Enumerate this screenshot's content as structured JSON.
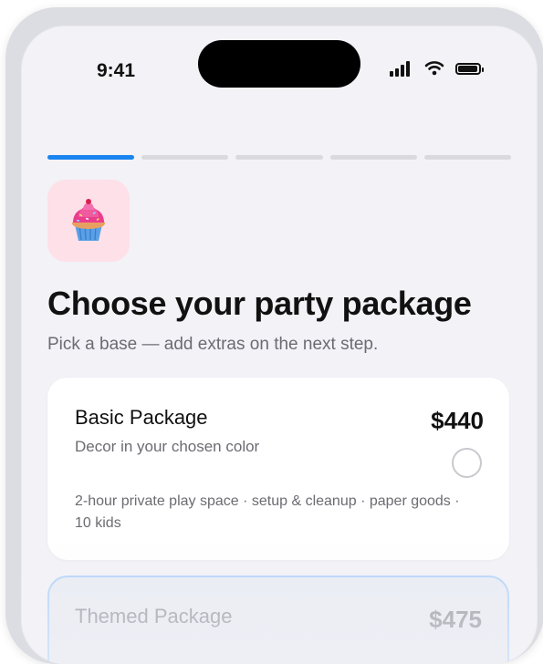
{
  "status_bar": {
    "time": "9:41",
    "icons": [
      "cellular-signal-icon",
      "wifi-icon",
      "battery-icon"
    ]
  },
  "progress": {
    "total_steps": 5,
    "current_step": 1
  },
  "header": {
    "icon": "cupcake-icon",
    "title": "Choose your party package",
    "subtitle": "Pick a base — add extras on the next step."
  },
  "packages": [
    {
      "name": "Basic Package",
      "price": "$440",
      "description": "Decor in your chosen color",
      "details": "2-hour private play space · setup & cleanup · paper goods · 10 kids",
      "selected": false
    },
    {
      "name": "Themed Package",
      "price": "$475"
    }
  ],
  "colors": {
    "accent": "#1a84f0",
    "screen_background": "#f2f2f7",
    "icon_tile": "#fde0e8",
    "text_primary": "#111111",
    "text_secondary": "#6b6b72"
  }
}
